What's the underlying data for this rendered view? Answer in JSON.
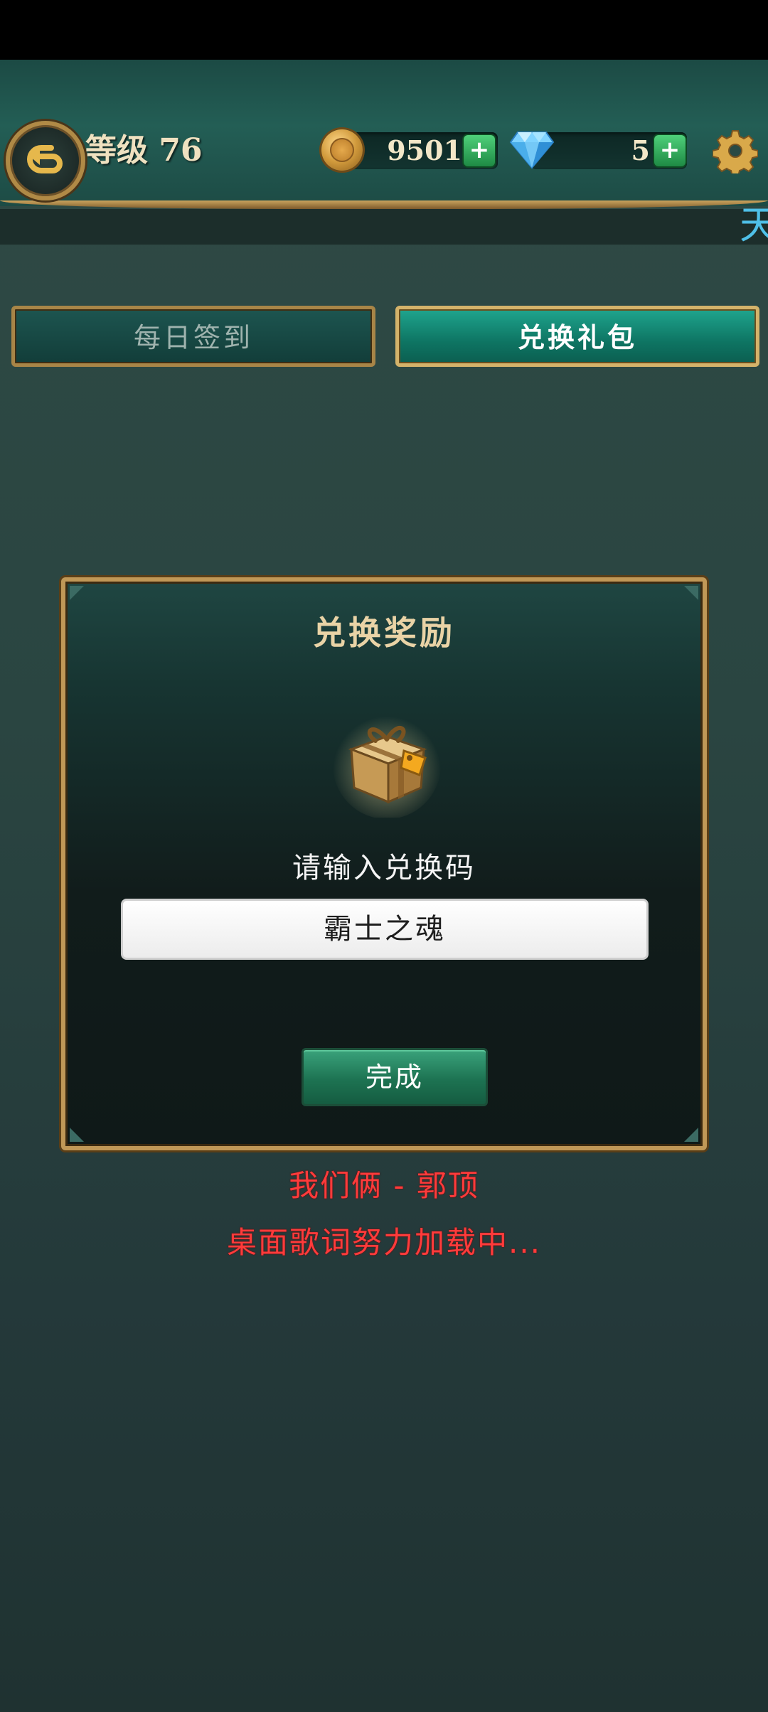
{
  "header": {
    "level_label": "等级 76",
    "coins": "9501",
    "gems": "5",
    "plus_label": "+",
    "marquee_text": "天"
  },
  "tabs": {
    "daily_checkin": "每日签到",
    "redeem_gift": "兑换礼包"
  },
  "dialog": {
    "title": "兑换奖励",
    "prompt": "请输入兑换码",
    "code_value": "霸士之魂",
    "done_label": "完成"
  },
  "lyrics": {
    "song": "我们俩 - 郭顶",
    "status": "桌面歌词努力加载中..."
  },
  "colors": {
    "accent_gold": "#c09857",
    "active_tab": "#1fa58e",
    "lyric_red": "#ff3b3b"
  }
}
